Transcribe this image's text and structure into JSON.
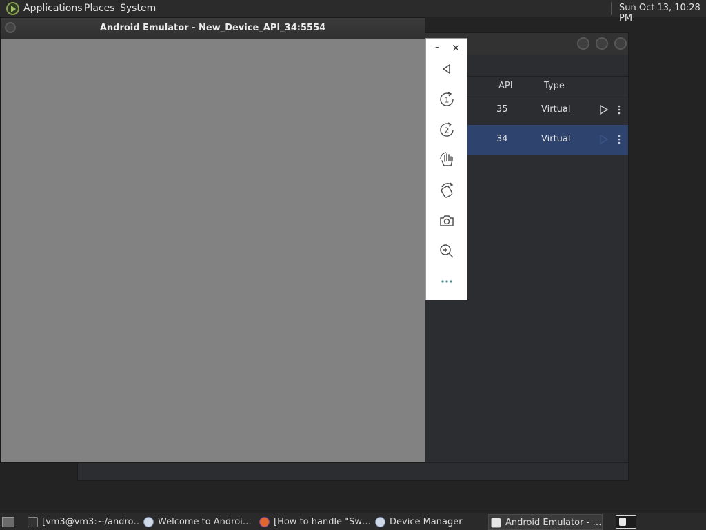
{
  "top_panel": {
    "menus": [
      "Applications",
      "Places",
      "System"
    ],
    "clock": "Sun Oct 13, 10:28 PM"
  },
  "emulator": {
    "title": "Android Emulator - New_Device_API_34:5554",
    "toolbar": {
      "minimize": "–",
      "close": "×",
      "buttons": [
        "back-icon",
        "rotate-left-icon",
        "rotate-right-icon",
        "gesture-icon",
        "power-icon",
        "camera-icon",
        "zoom-icon",
        "more-icon"
      ]
    }
  },
  "device_manager": {
    "columns": {
      "api": "API",
      "type": "Type"
    },
    "rows": [
      {
        "api": "35",
        "type": "Virtual",
        "selected": false
      },
      {
        "api": "34",
        "type": "Virtual",
        "selected": true
      }
    ],
    "colors": {
      "selected_row": "#2e436e",
      "background": "#2b2d30"
    }
  },
  "taskbar": {
    "tasks": [
      {
        "label": "[vm3@vm3:~/andro…",
        "icon": "terminal-icon"
      },
      {
        "label": "Welcome to Androi…",
        "icon": "android-studio-icon"
      },
      {
        "label": "[How to handle \"Sw…",
        "icon": "firefox-icon"
      },
      {
        "label": "Device Manager",
        "icon": "android-studio-icon"
      },
      {
        "label": "Android Emulator - …",
        "icon": "emulator-icon",
        "active": true
      }
    ]
  }
}
